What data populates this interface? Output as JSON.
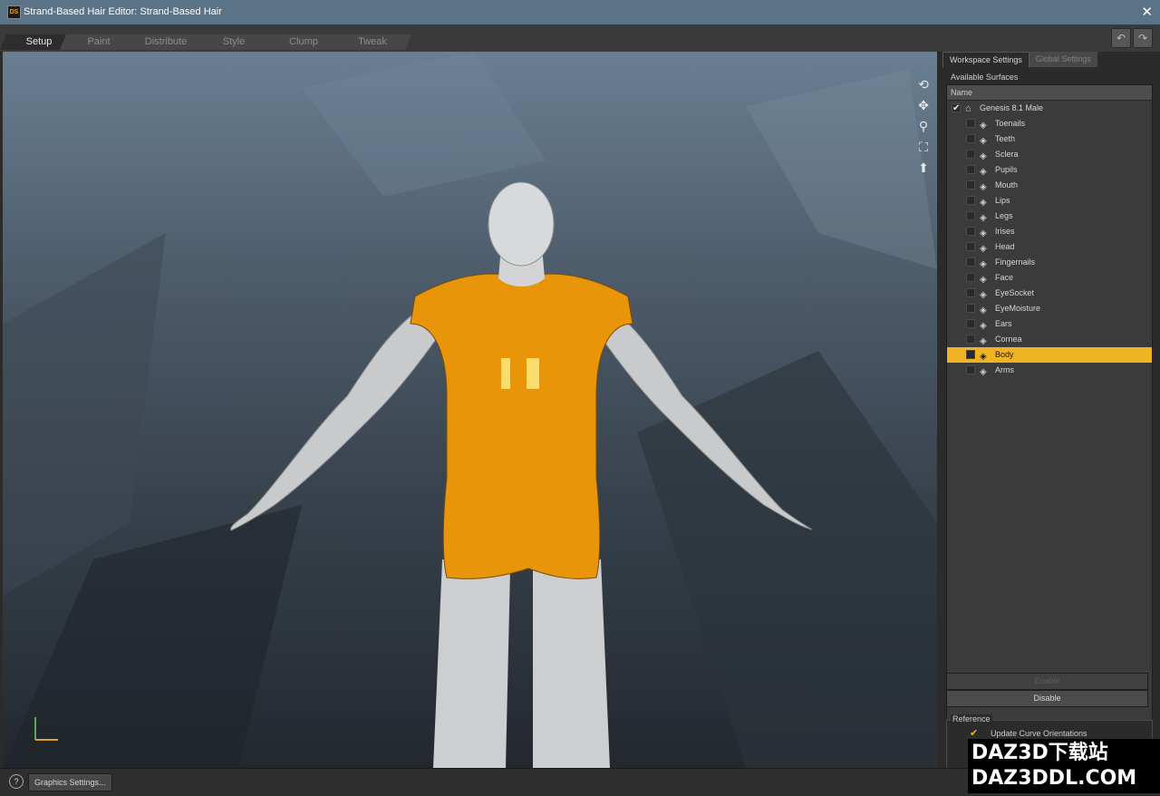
{
  "window": {
    "title": "Strand-Based Hair Editor: Strand-Based Hair",
    "app_badge": "DS"
  },
  "tabs": [
    {
      "label": "Setup",
      "active": true
    },
    {
      "label": "Paint"
    },
    {
      "label": "Distribute"
    },
    {
      "label": "Style"
    },
    {
      "label": "Clump"
    },
    {
      "label": "Tweak"
    }
  ],
  "panel": {
    "tabs": [
      "Workspace Settings",
      "Global Settings"
    ],
    "available_surfaces_label": "Available Surfaces",
    "name_column": "Name",
    "root": "Genesis 8.1 Male",
    "surfaces": [
      {
        "label": "Toenails"
      },
      {
        "label": "Teeth"
      },
      {
        "label": "Sclera"
      },
      {
        "label": "Pupils"
      },
      {
        "label": "Mouth"
      },
      {
        "label": "Lips"
      },
      {
        "label": "Legs"
      },
      {
        "label": "Irises"
      },
      {
        "label": "Head"
      },
      {
        "label": "Fingernails"
      },
      {
        "label": "Face"
      },
      {
        "label": "EyeSocket"
      },
      {
        "label": "EyeMoisture"
      },
      {
        "label": "Ears"
      },
      {
        "label": "Cornea"
      },
      {
        "label": "Body",
        "selected": true
      },
      {
        "label": "Arms"
      }
    ],
    "enable_label": "Enable",
    "disable_label": "Disable",
    "reference_label": "Reference",
    "update_curve_label": "Update Curve Orientations"
  },
  "bottom": {
    "graphics_settings": "Graphics Settings..."
  },
  "watermark": {
    "line1": "DAZ3D下载站",
    "line2": "DAZ3DDL.COM"
  },
  "colors": {
    "selection": "#f0b324",
    "body_highlight": "#e8950a"
  }
}
